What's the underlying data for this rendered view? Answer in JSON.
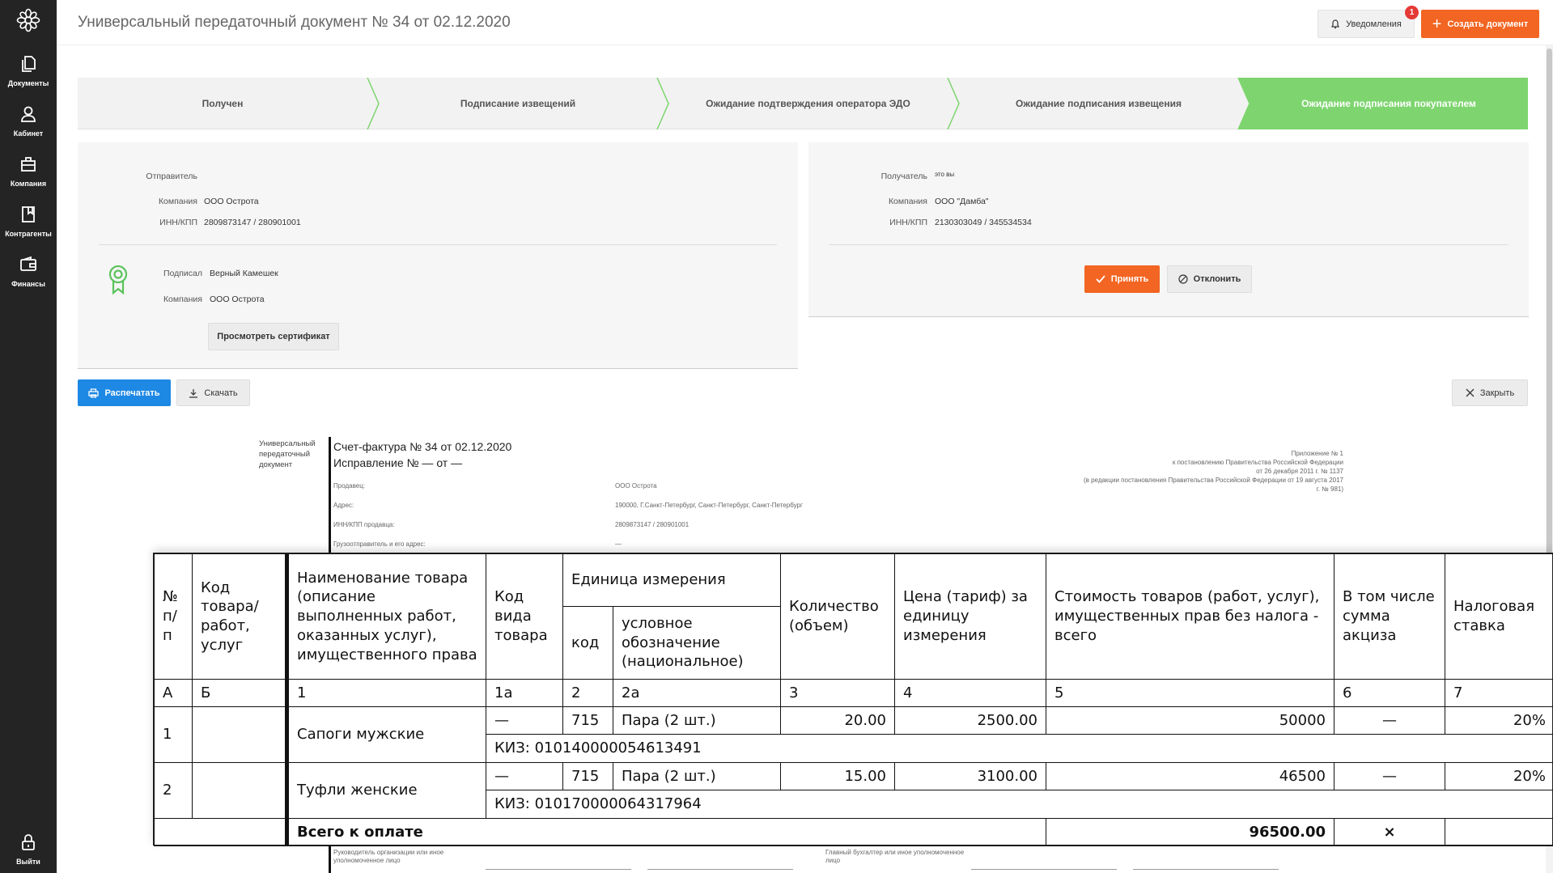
{
  "sidebar": {
    "items": [
      {
        "label": "Документы",
        "icon": "documents-icon"
      },
      {
        "label": "Кабинет",
        "icon": "user-icon"
      },
      {
        "label": "Компания",
        "icon": "company-icon"
      },
      {
        "label": "Контрагенты",
        "icon": "contractors-icon"
      },
      {
        "label": "Финансы",
        "icon": "wallet-icon"
      }
    ],
    "logout_label": "Выйти"
  },
  "header": {
    "title": "Универсальный передаточный документ № 34 от 02.12.2020",
    "notifications_label": "Уведомления",
    "notifications_count": "1",
    "create_label": "Создать документ"
  },
  "stepper": {
    "steps": [
      {
        "label": "Получен",
        "active": false
      },
      {
        "label": "Подписание извещений",
        "active": false
      },
      {
        "label": "Ожидание подтверждения оператора ЭДО",
        "active": false
      },
      {
        "label": "Ожидание подписания извещения",
        "active": false
      },
      {
        "label": "Ожидание подписания покупателем",
        "active": true
      }
    ],
    "active_color": "#7ed56f"
  },
  "sender": {
    "title": "Отправитель",
    "company_label": "Компания",
    "company_value": "ООО Острота",
    "inn_label": "ИНН/КПП",
    "inn_value": "2809873147 / 280901001",
    "signed_label": "Подписал",
    "signed_value": "Верный Камешек",
    "sign_company_label": "Компания",
    "sign_company_value": "ООО Острота",
    "cert_button": "Просмотреть сертификат"
  },
  "receiver": {
    "title": "Получатель",
    "badge": "это вы",
    "company_label": "Компания",
    "company_value": "ООО \"Дамба\"",
    "inn_label": "ИНН/КПП",
    "inn_value": "2130303049 / 345534534",
    "accept_button": "Принять",
    "reject_button": "Отклонить"
  },
  "actions": {
    "print": "Распечатать",
    "download": "Скачать",
    "close": "Закрыть"
  },
  "document": {
    "side_title": "Универсальный передаточный документ",
    "invoice_line": "Счет-фактура № 34 от 02.12.2020",
    "correction_line": "Исправление № — от —",
    "appendix": [
      "Приложение № 1",
      "к постановлению Правительства Российской Федерации",
      "от 26 декабря 2011 г. № 1137",
      "(в редакции постановления Правительства Российской Федерации от 19 августа 2017",
      "г. № 981)"
    ],
    "fields": [
      {
        "label": "Продавец:",
        "value": "ООО Острота"
      },
      {
        "label": "Адрес:",
        "value": "190000, Г.Санкт-Петербург, Санкт-Петербург, Санкт-Петербург"
      },
      {
        "label": "ИНН/КПП продавца:",
        "value": "2809873147 / 280901001"
      },
      {
        "label": "Грузоотправитель и его адрес:",
        "value": "—"
      }
    ],
    "footer_left": "Руководитель организации или иное уполномоченное лицо",
    "footer_right": "Главный бухгалтер или иное уполномоченное лицо"
  },
  "invoice_table": {
    "headers": {
      "num": "№ п/ п",
      "code": "Код товара/ работ, услуг",
      "name": "Наименование товара (описание выполненных работ, оказанных услуг), имущественного права",
      "kind": "Код вида товара",
      "unit": "Единица измерения",
      "unit_code": "код",
      "unit_name": "условное обозначение (национальное)",
      "qty": "Количество (объем)",
      "price": "Цена (тариф) за единицу измерения",
      "cost": "Стоимость товаров (работ, услуг), имущественных прав без налога - всего",
      "excise": "В том числе сумма акциза",
      "rate": "Налоговая ставка"
    },
    "index_row": [
      "А",
      "Б",
      "1",
      "1а",
      "2",
      "2а",
      "3",
      "4",
      "5",
      "6",
      "7"
    ],
    "rows": [
      {
        "num": "1",
        "code": "",
        "name": "Сапоги мужские",
        "kind": "—",
        "unit_code": "715",
        "unit_name": "Пара (2 шт.)",
        "qty": "20.00",
        "price": "2500.00",
        "cost": "50000",
        "excise": "—",
        "rate": "20%",
        "kiz": "КИЗ: 010140000054613491"
      },
      {
        "num": "2",
        "code": "",
        "name": "Туфли женские",
        "kind": "—",
        "unit_code": "715",
        "unit_name": "Пара (2 шт.)",
        "qty": "15.00",
        "price": "3100.00",
        "cost": "46500",
        "excise": "—",
        "rate": "20%",
        "kiz": "КИЗ: 010170000064317964"
      }
    ],
    "total_label": "Всего к оплате",
    "total_value": "96500.00",
    "total_mark": "×"
  }
}
